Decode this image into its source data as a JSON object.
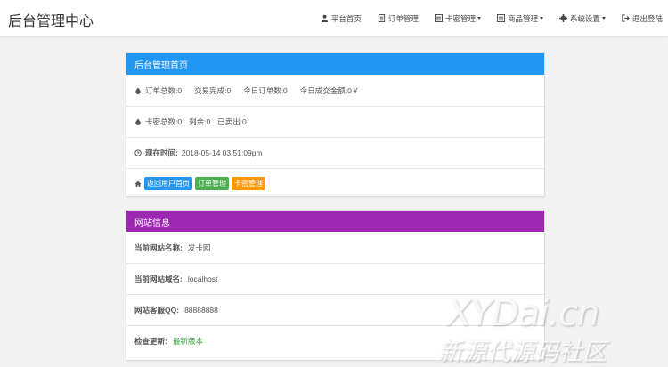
{
  "header": {
    "brand": "后台管理中心",
    "nav": [
      {
        "label": "平台首页",
        "icon": "user-icon",
        "dropdown": false
      },
      {
        "label": "订单管理",
        "icon": "file-icon",
        "dropdown": false
      },
      {
        "label": "卡密管理",
        "icon": "list-icon",
        "dropdown": true
      },
      {
        "label": "商品管理",
        "icon": "list-icon",
        "dropdown": true
      },
      {
        "label": "系统设置",
        "icon": "gear-icon",
        "dropdown": true
      },
      {
        "label": "退出登陆",
        "icon": "logout-icon",
        "dropdown": false
      }
    ]
  },
  "panel_home": {
    "title": "后台管理首页",
    "header_color": "#2196f3",
    "stats1": [
      "订单总数:0",
      "交易完成:0",
      "今日订单数:0",
      "今日成交金额:0￥"
    ],
    "stats2": [
      "卡密总数:0",
      "剩余:0",
      "已卖出:0"
    ],
    "time_label": "现在时间:",
    "time_value": "2018-05-14 03:51:09pm",
    "links": [
      {
        "label": "返回用户首页",
        "color": "#2196f3"
      },
      {
        "label": "订单管理",
        "color": "#4caf50"
      },
      {
        "label": "卡密管理",
        "color": "#ff9800"
      }
    ]
  },
  "panel_site": {
    "title": "网站信息",
    "header_color": "#9c27b0",
    "rows": [
      {
        "label": "当前网站名称:",
        "value": "发卡网"
      },
      {
        "label": "当前网站域名:",
        "value": "localhost"
      },
      {
        "label": "网站客服QQ:",
        "value": "88888888"
      },
      {
        "label": "检查更新:",
        "value": "最新版本"
      }
    ]
  },
  "watermark": {
    "line1": "XYDai.cn",
    "line2": "新源代源码社区"
  }
}
